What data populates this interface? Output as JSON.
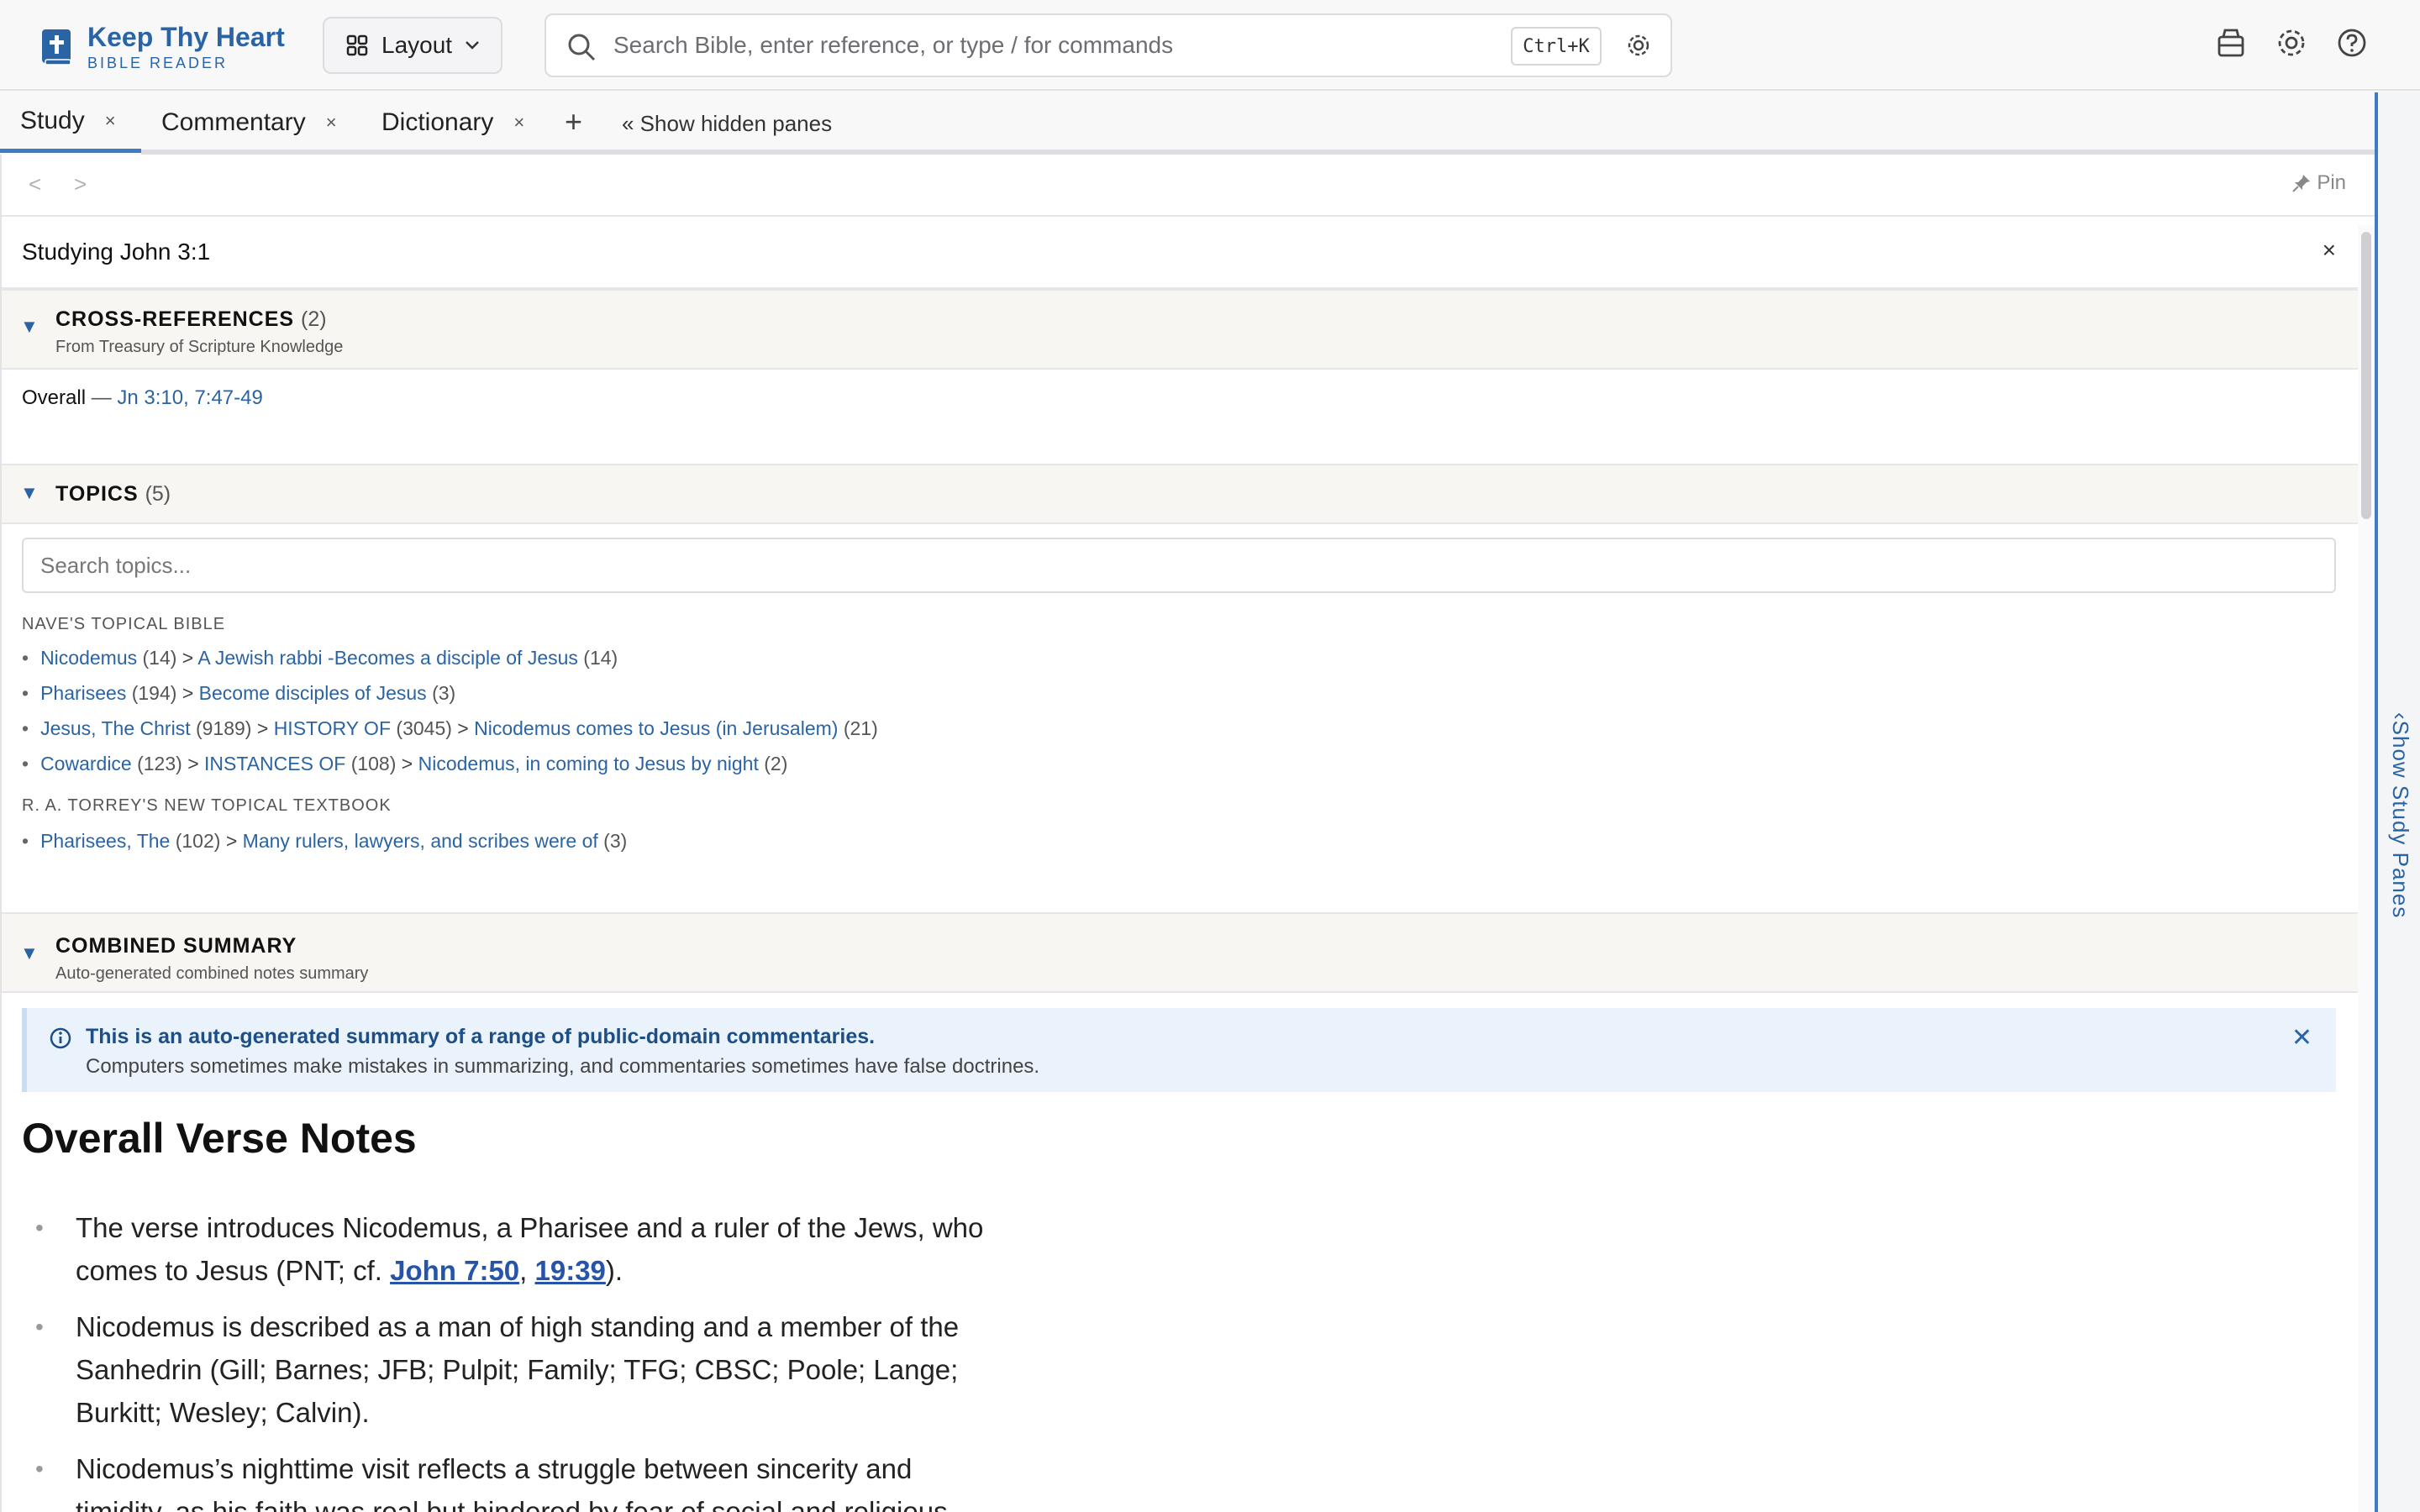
{
  "app": {
    "title": "Keep Thy Heart",
    "subtitle": "BIBLE READER"
  },
  "toolbar": {
    "layout_label": "Layout",
    "search_placeholder": "Search Bible, enter reference, or type / for commands",
    "shortcut": "Ctrl+K"
  },
  "tabs": [
    {
      "label": "Study",
      "close": "×"
    },
    {
      "label": "Commentary",
      "close": "×"
    },
    {
      "label": "Dictionary",
      "close": "×"
    }
  ],
  "tab_add": "+",
  "show_hidden": "« Show hidden panes",
  "nav": {
    "back": "<",
    "forward": ">",
    "pin": "Pin"
  },
  "studying": {
    "title": "Studying John 3:1",
    "close": "×"
  },
  "cross_refs": {
    "title": "CROSS-REFERENCES",
    "count": "(2)",
    "source": "From Treasury of Scripture Knowledge",
    "overall_label": "Overall",
    "dash": "—",
    "refs": "Jn 3:10, 7:47-49"
  },
  "topics": {
    "title": "TOPICS",
    "count": "(5)",
    "search_placeholder": "Search topics...",
    "sources": [
      {
        "name": "NAVE'S TOPICAL BIBLE",
        "entries": [
          [
            {
              "t": "Nicodemus",
              "n": "(14)"
            },
            {
              "t": "A Jewish rabbi -Becomes a disciple of Jesus",
              "n": "(14)"
            }
          ],
          [
            {
              "t": "Pharisees",
              "n": "(194)"
            },
            {
              "t": "Become disciples of Jesus",
              "n": "(3)"
            }
          ],
          [
            {
              "t": "Jesus, The Christ",
              "n": "(9189)"
            },
            {
              "t": "HISTORY OF",
              "n": "(3045)"
            },
            {
              "t": "Nicodemus comes to Jesus (in Jerusalem)",
              "n": "(21)"
            }
          ],
          [
            {
              "t": "Cowardice",
              "n": "(123)"
            },
            {
              "t": "INSTANCES OF",
              "n": "(108)"
            },
            {
              "t": "Nicodemus, in coming to Jesus by night",
              "n": "(2)"
            }
          ]
        ]
      },
      {
        "name": "R. A. TORREY'S NEW TOPICAL TEXTBOOK",
        "entries": [
          [
            {
              "t": "Pharisees, The",
              "n": "(102)"
            },
            {
              "t": "Many rulers, lawyers, and scribes were of",
              "n": "(3)"
            }
          ]
        ]
      }
    ]
  },
  "summary": {
    "title": "COMBINED SUMMARY",
    "subtitle": "Auto-generated combined notes summary",
    "notice_title": "This is an auto-generated summary of a range of public-domain commentaries.",
    "notice_body": "Computers sometimes make mistakes in summarizing, and commentaries sometimes have false doctrines.",
    "notice_close": "✕",
    "heading": "Overall Verse Notes",
    "bullets": [
      {
        "pre": "The verse introduces Nicodemus, a Pharisee and a ruler of the Jews, who comes to Jesus (PNT; cf. ",
        "link1": "John 7:50",
        "mid": ", ",
        "link2": "19:39",
        "post": ")."
      },
      {
        "pre": "Nicodemus is described as a man of high standing and a member of the Sanhedrin (Gill; Barnes; JFB; Pulpit; Family; TFG; CBSC; Poole; Lange; Burkitt; Wesley; Calvin).",
        "link1": "",
        "mid": "",
        "link2": "",
        "post": ""
      },
      {
        "pre": "Nicodemus’s nighttime visit reflects a struggle between sincerity and timidity, as his faith was real but hindered by fear of social and religious",
        "link1": "",
        "mid": "",
        "link2": "",
        "post": ""
      }
    ]
  },
  "side_pane": {
    "label": "‹Show Study Panes"
  },
  "colors": {
    "accent": "#2b64a4",
    "tab_active": "#3d7cc4",
    "section_bg": "#f7f6f2",
    "notice_bg": "#eaf3fc"
  }
}
